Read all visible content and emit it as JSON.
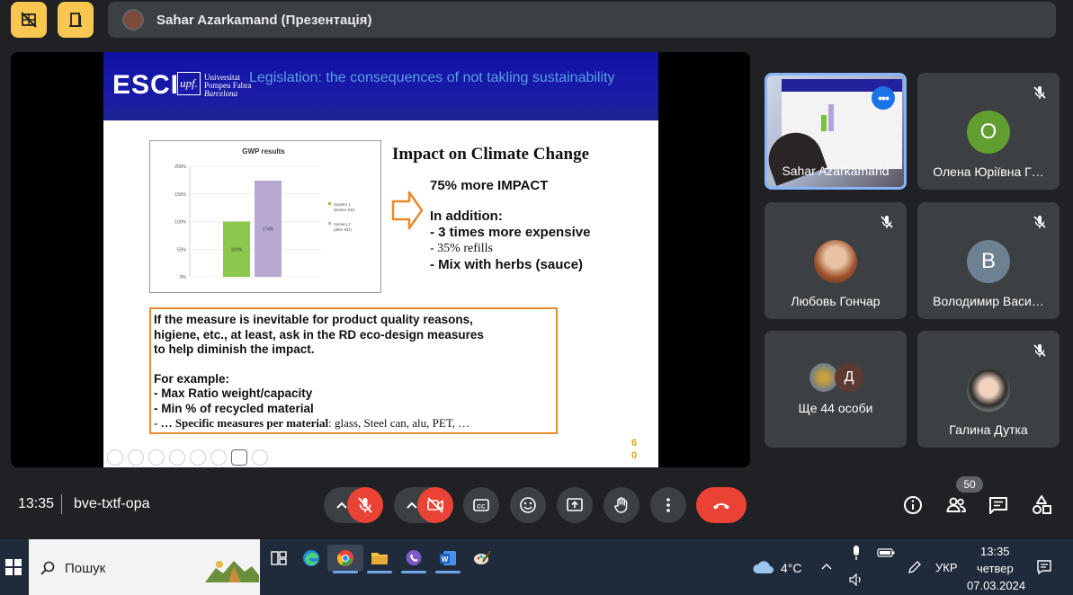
{
  "top_bar": {
    "presenter_label": "Sahar Azarkamand (Презентація)"
  },
  "slide": {
    "logo_text": "ESCI",
    "upf_mark": "upf.",
    "upf_lines": [
      "Universitat",
      "Pompeu Fabra",
      "Barcelona"
    ],
    "title": "Legislation: the consequences of not takling sustainability",
    "impact_title": "Impact on Climate Change",
    "impact_line1": "75% more IMPACT",
    "addition_header": "In addition:",
    "addition_1": "- 3 times more expensive",
    "addition_2": "- 35% refills",
    "addition_3": "- Mix with herbs (sauce)",
    "note_lines": [
      "If the measure is inevitable for product quality reasons,",
      "higiene, etc., at least, ask in the RD eco-design measures",
      "to help diminish the impact."
    ],
    "example_header": "For example:",
    "example_1": "- Max Ratio weight/capacity",
    "example_2": "- Min % of recycled material",
    "example_3_bold": "- … Specific measures per material",
    "example_3_rest": ": glass, Steel can, alu, PET, …",
    "slide_number_top": "6",
    "slide_number_bottom": "0"
  },
  "chart_data": {
    "type": "bar",
    "title": "GWP results",
    "categories": [
      "System 1 (before RD)",
      "System 2 (after RD)"
    ],
    "values": [
      100,
      174
    ],
    "value_labels": [
      "100%",
      "174%"
    ],
    "ylim": [
      0,
      200
    ],
    "yticks": [
      "0%",
      "50%",
      "100%",
      "150%",
      "200%"
    ],
    "legend": [
      {
        "line1": "System 1",
        "line2": "(before RD)",
        "color": "#8cc84b"
      },
      {
        "line1": "System 2",
        "line2": "(after RD)",
        "color": "#b7a8d2"
      }
    ],
    "legend_position": "right"
  },
  "participants": [
    {
      "name": "Sahar Azarkamand",
      "type": "video"
    },
    {
      "name": "Олена Юріївна Г…",
      "initial": "О",
      "color": "#5f9e2f"
    },
    {
      "name": "Любовь Гончар",
      "type": "photo"
    },
    {
      "name": "Володимир Васи…",
      "initial": "В",
      "color": "#6e8193"
    },
    {
      "name": "Ще 44 особи",
      "second_initial": "Д"
    },
    {
      "name": "Галина Дутка",
      "type": "photo"
    }
  ],
  "controls": {
    "time": "13:35",
    "meeting_code": "bve-txtf-opa",
    "participants_count": "50"
  },
  "taskbar": {
    "search_label": "Пошук",
    "weather": "4°C",
    "language": "УКР",
    "time": "13:35",
    "day": "четвер",
    "date": "07.03.2024"
  },
  "colors": {
    "accent_yellow": "#f9c74f",
    "end_call_red": "#ea4335",
    "slide_blue": "#1a1aa8",
    "note_border": "#e58b2b"
  }
}
